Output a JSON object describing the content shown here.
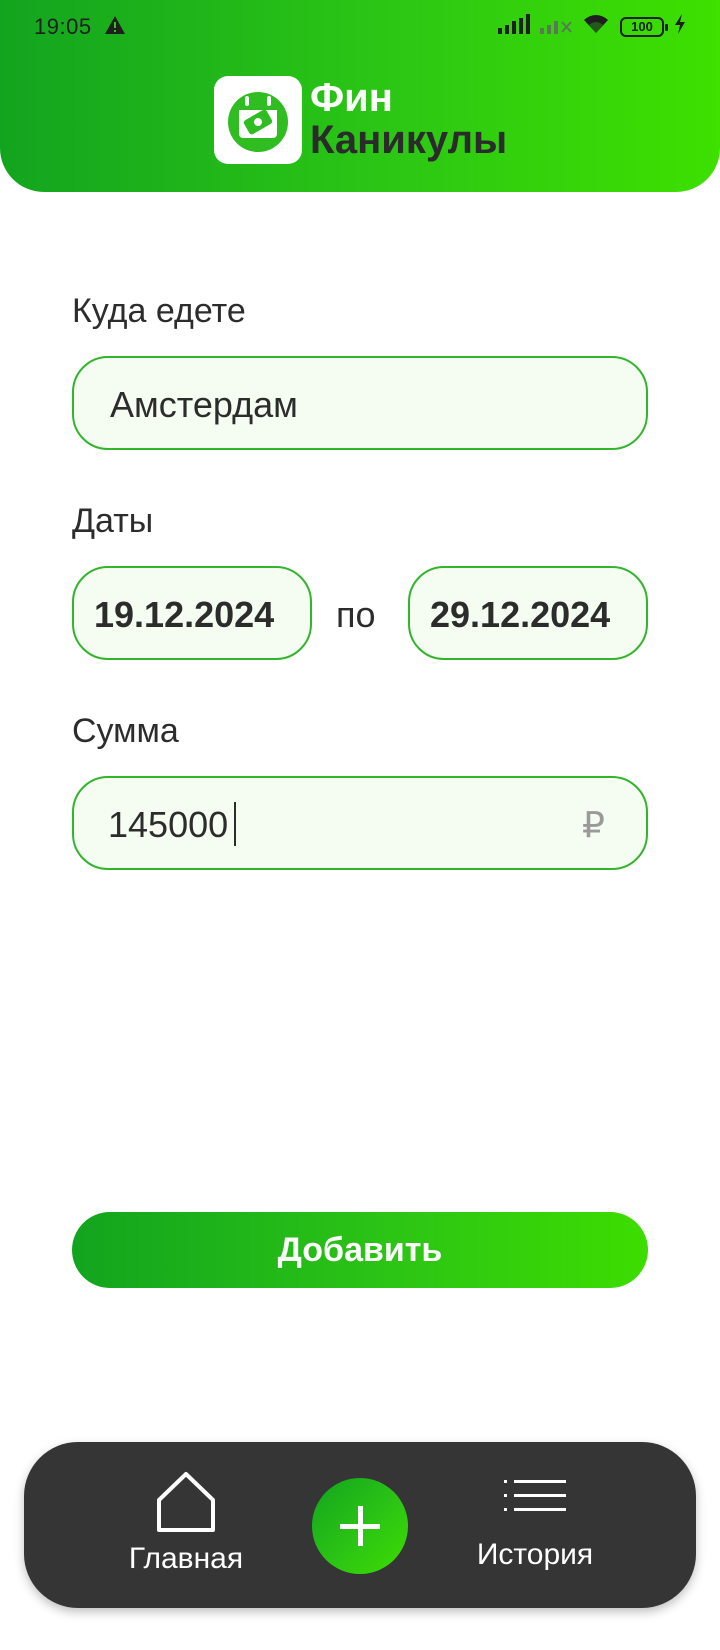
{
  "status_bar": {
    "time": "19:05",
    "battery": "100"
  },
  "brand": {
    "line1": "Фин",
    "line2": "Каникулы"
  },
  "form": {
    "destination_label": "Куда едете",
    "destination_value": "Амстердам",
    "dates_label": "Даты",
    "date_from": "19.12.2024",
    "date_sep": "по",
    "date_to": "29.12.2024",
    "amount_label": "Сумма",
    "amount_value": "145000",
    "currency": "₽"
  },
  "add_button": "Добавить",
  "bottom_nav": {
    "home_label": "Главная",
    "history_label": "История"
  },
  "colors": {
    "accent_start": "#12a41e",
    "accent_end": "#3ddd00",
    "field_border": "#31b52b",
    "nav_bg": "#353535"
  }
}
